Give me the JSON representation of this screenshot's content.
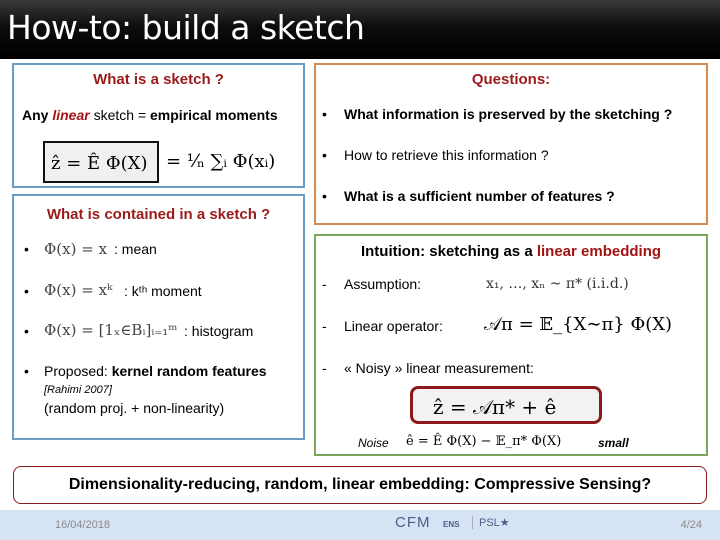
{
  "slide": {
    "title": "How-to: build a sketch"
  },
  "box_what_is_sketch": {
    "heading": "What is a sketch ?",
    "line_pre": "Any ",
    "line_linear": "linear",
    "line_mid": " sketch = ",
    "line_bold": "empirical moments",
    "equation_boxed": "ẑ = Ê Φ(X)",
    "equation_rest": "= ¹⁄ₙ ∑ᵢ Φ(xᵢ)"
  },
  "box_contained": {
    "heading": "What is contained in a sketch ?",
    "items": [
      {
        "math": "Φ(x) = x",
        "label": " : mean"
      },
      {
        "math": "Φ(x) = xᵏ",
        "label": " :  kᵗʰ moment"
      },
      {
        "math": "Φ(x) = [1ₓ∈Bᵢ]ᵢ₌₁ᵐ",
        "label": " : histogram"
      }
    ],
    "proposed_pre": "Proposed: ",
    "proposed_bold": "kernel random features",
    "citation": "[Rahimi 2007]",
    "note": "(random proj. + non-linearity)"
  },
  "box_questions": {
    "heading": "Questions:",
    "items": [
      {
        "text": "What information is preserved by the sketching ?",
        "bold": true
      },
      {
        "text": "How to retrieve this information ?",
        "bold": false
      },
      {
        "text": "What is a sufficient number of features ?",
        "bold": true
      }
    ]
  },
  "box_intuition": {
    "heading_pre": "Intuition: sketching as a ",
    "heading_red": "linear embedding",
    "items": [
      {
        "label": "Assumption:",
        "math": "x₁, …, xₙ ~ π*  (i.i.d.)"
      },
      {
        "label": "Linear operator:",
        "math": "𝒜π = 𝔼_{X∼π} Φ(X)"
      },
      {
        "label": "« Noisy » linear measurement:",
        "math": ""
      }
    ],
    "boxed_equation": "ẑ = 𝒜π* + ê",
    "noise_label": "Noise",
    "noise_equation": "ê = Ê Φ(X) − 𝔼_π* Φ(X)",
    "noise_suffix": "small"
  },
  "banner": {
    "text": "Dimensionality-reducing, random, linear embedding: Compressive Sensing?"
  },
  "footer": {
    "date": "16/04/2018",
    "logos": [
      "CFM",
      "ENS",
      "PSL★"
    ],
    "page": "4/24"
  }
}
